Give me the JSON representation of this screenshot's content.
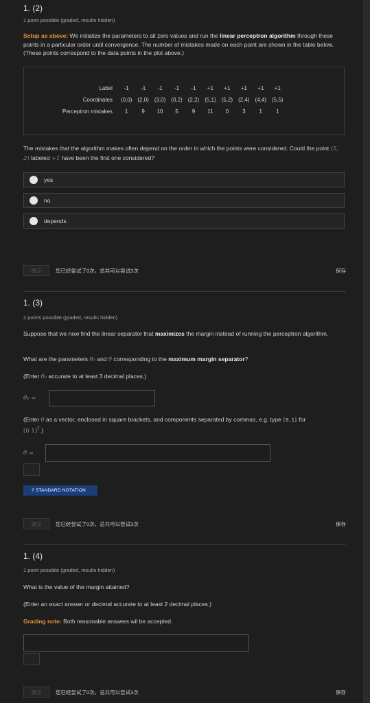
{
  "q12": {
    "title": "1. (2)",
    "points": "1 point possible (graded, results hidden)",
    "intro_label": "Setup as above:",
    "intro_a": " We initialize the parameters to all zero values and run the ",
    "intro_bold": "linear perceptron algorithm",
    "intro_b": " through these points in a particular order until convergence. The number of mistakes made on each point are shown in the table below. (These points correspond to the data points in the plot above.)",
    "table": {
      "row_labels": [
        "Label",
        "Coordinates",
        "Perceptron mistakes"
      ],
      "labels": [
        "-1",
        "-1",
        "-1",
        "-1",
        "-1",
        "+1",
        "+1",
        "+1",
        "+1",
        "+1"
      ],
      "coordinates": [
        "(0,0)",
        "(2,0)",
        "(3,0)",
        "(0,2)",
        "(2,2)",
        "(5,1)",
        "(5,2)",
        "(2,4)",
        "(4,4)",
        "(5,5)"
      ],
      "mistakes": [
        "1",
        "9",
        "10",
        "5",
        "9",
        "11",
        "0",
        "3",
        "1",
        "1"
      ]
    },
    "question_a": "The mistakes that the algorithm makes often depend on the order in which the points were considered. Could the point ",
    "question_point": "(5, 2)",
    "question_b": " labeled ",
    "question_label": "+1",
    "question_c": " have been the first one considered?",
    "options": [
      "yes",
      "no",
      "depends"
    ],
    "submit": "提交",
    "attempts": "您已经尝试了0次，总共可以尝试3次",
    "save": "保存"
  },
  "q13": {
    "title": "1. (3)",
    "points": "2 points possible (graded, results hidden)",
    "text_a": "Suppose that we now find the linear separator that ",
    "text_bold": "maximizes",
    "text_b": " the margin instead of running the perceptron algorithm.",
    "q_a": "What are the parameters ",
    "theta0": "θ₀",
    "q_and": " and ",
    "theta": "θ",
    "q_b": " corresponding to the ",
    "q_bold": "maximum margin separator",
    "q_c": "?",
    "enter0_a": "(Enter ",
    "enter0_b": " accurate to at least 3 decimal places.)",
    "label_theta0": "θ₀ =",
    "enter_a": "(Enter ",
    "enter_b": " as a vector, enclosed in square brackets, and components separated by commas, e.g. type ",
    "enter_code": "[0,1]",
    "enter_c": " for",
    "enter_vec": "[0   1]",
    "enter_sup": "T",
    "enter_d": ".)",
    "label_theta": "θ =",
    "notation": "?  STANDARD NOTATION",
    "submit": "提交",
    "attempts": "您已经尝试了0次，总共可以尝试3次",
    "save": "保存"
  },
  "q14": {
    "title": "1. (4)",
    "points": "1 point possible (graded, results hidden)",
    "question": "What is the value of the margin attained?",
    "enter": "(Enter an exact answer or decimal accurate to at least 2 decimal places.)",
    "grading_label": "Grading note:",
    "grading": " Both reasonable answers wil be accepted.",
    "submit": "提交",
    "attempts": "您已经尝试了0次，总共可以尝试3次",
    "save": "保存"
  }
}
